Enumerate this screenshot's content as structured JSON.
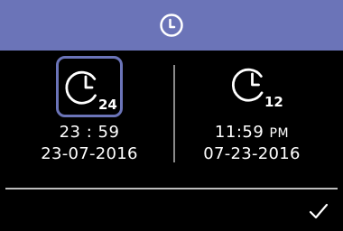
{
  "header": {
    "icon": "clock-icon",
    "color": "#6b74b8"
  },
  "options": [
    {
      "format": "24",
      "selected": true,
      "time": "23 : 59",
      "date": "23-07-2016"
    },
    {
      "format": "12",
      "selected": false,
      "time": "11:59",
      "ampm": "PM",
      "date": "07-23-2016"
    }
  ],
  "confirm": {
    "icon": "checkmark-icon"
  }
}
